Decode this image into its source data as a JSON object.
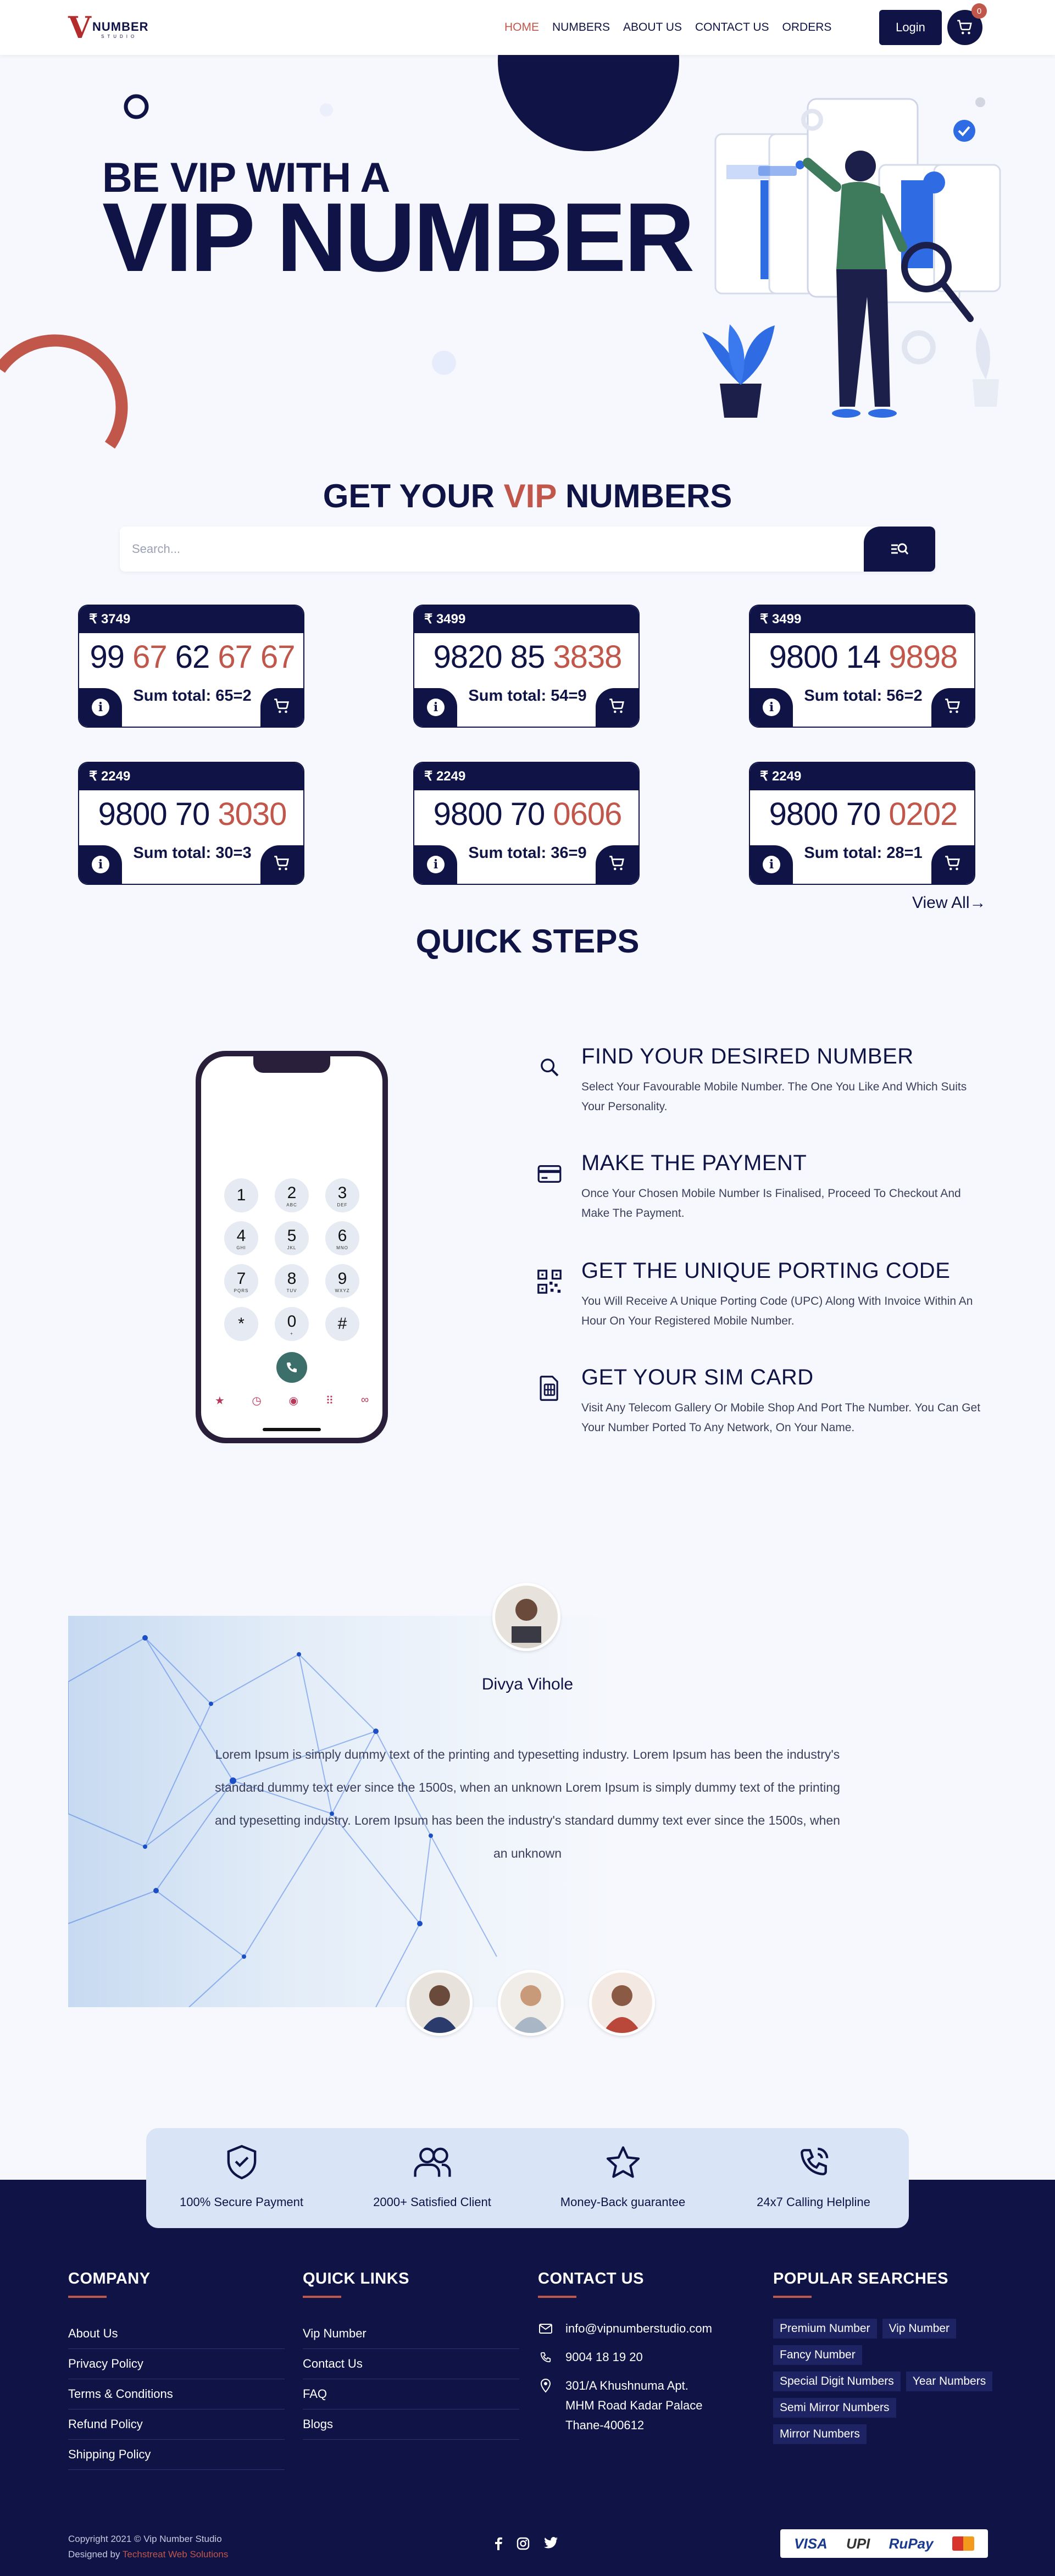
{
  "nav": {
    "logo": {
      "mark": "V",
      "name": "NUMBER",
      "sub": "STUDIO"
    },
    "links": [
      "HOME",
      "NUMBERS",
      "ABOUT US",
      "CONTACT US",
      "ORDERS"
    ],
    "login": "Login",
    "cart_count": "0"
  },
  "hero": {
    "line1": "BE VIP WITH A",
    "line2": "VIP NUMBER"
  },
  "numbers_section": {
    "title_pre": "GET YOUR ",
    "title_accent": "VIP",
    "title_post": " NUMBERS",
    "search_placeholder": "Search...",
    "cards": [
      {
        "price": "₹ 3749",
        "num_plain": "99 ",
        "num_parts": [
          [
            "99 ",
            false
          ],
          [
            "67",
            true
          ],
          [
            " 62 ",
            false
          ],
          [
            "67 67",
            true
          ]
        ],
        "sum": "Sum total: 65=2"
      },
      {
        "price": "₹ 3499",
        "num_parts": [
          [
            "9820 85 ",
            false
          ],
          [
            "3838",
            true
          ]
        ],
        "sum": "Sum total: 54=9"
      },
      {
        "price": "₹ 3499",
        "num_parts": [
          [
            "9800 14 ",
            false
          ],
          [
            "9898",
            true
          ]
        ],
        "sum": "Sum total: 56=2"
      },
      {
        "price": "₹ 2249",
        "num_parts": [
          [
            "9800 70 ",
            false
          ],
          [
            "3030",
            true
          ]
        ],
        "sum": "Sum total: 30=3"
      },
      {
        "price": "₹ 2249",
        "num_parts": [
          [
            "9800 70 ",
            false
          ],
          [
            "0606",
            true
          ]
        ],
        "sum": "Sum total: 36=9"
      },
      {
        "price": "₹ 2249",
        "num_parts": [
          [
            "9800 70 ",
            false
          ],
          [
            "0202",
            true
          ]
        ],
        "sum": "Sum total: 28=1"
      }
    ],
    "view_all": "View All→"
  },
  "steps": {
    "title": "QUICK STEPS",
    "keypad": [
      [
        "1",
        ""
      ],
      [
        "2",
        "ABC"
      ],
      [
        "3",
        "DEF"
      ],
      [
        "4",
        "GHI"
      ],
      [
        "5",
        "JKL"
      ],
      [
        "6",
        "MNO"
      ],
      [
        "7",
        "PQRS"
      ],
      [
        "8",
        "TUV"
      ],
      [
        "9",
        "WXYZ"
      ],
      [
        "*",
        ""
      ],
      [
        "0",
        "+"
      ],
      [
        "#",
        ""
      ]
    ],
    "items": [
      {
        "icon": "search-icon",
        "title": "FIND YOUR DESIRED NUMBER",
        "text": "Select Your Favourable Mobile Number. The One You Like And Which Suits Your Personality."
      },
      {
        "icon": "credit-card-icon",
        "title": "MAKE THE PAYMENT",
        "text": "Once Your Chosen Mobile Number Is Finalised, Proceed To Checkout And Make The Payment."
      },
      {
        "icon": "qr-code-icon",
        "title": "GET THE UNIQUE PORTING CODE",
        "text": "You Will Receive A Unique Porting Code (UPC) Along With Invoice Within An Hour On Your Registered Mobile Number."
      },
      {
        "icon": "sim-card-icon",
        "title": "GET YOUR SIM CARD",
        "text": "Visit Any Telecom Gallery Or Mobile Shop And Port The Number. You Can Get Your Number Ported To Any Network, On Your Name."
      }
    ]
  },
  "testimonial": {
    "name": "Divya Vihole",
    "text": "Lorem Ipsum is simply dummy text of the printing and typesetting industry. Lorem Ipsum has been the industry's standard dummy text ever since the 1500s, when an unknown Lorem Ipsum is simply dummy text of the printing and typesetting industry. Lorem Ipsum has been the industry's standard dummy text ever since the 1500s, when an unknown"
  },
  "features": [
    {
      "icon": "shield-check-icon",
      "label": "100% Secure Payment"
    },
    {
      "icon": "users-icon",
      "label": "2000+ Satisfied Client"
    },
    {
      "icon": "star-icon",
      "label": "Money-Back guarantee"
    },
    {
      "icon": "phone-call-icon",
      "label": "24x7 Calling Helpline"
    }
  ],
  "footer": {
    "company": {
      "title": "COMPANY",
      "links": [
        "About Us",
        "Privacy Policy",
        "Terms & Conditions",
        "Refund Policy",
        "Shipping Policy"
      ]
    },
    "quick_links": {
      "title": "QUICK LINKS",
      "links": [
        "Vip Number",
        "Contact Us",
        "FAQ",
        "Blogs"
      ]
    },
    "contact": {
      "title": "CONTACT US",
      "email": "info@vipnumberstudio.com",
      "phone": "9004 18 19 20",
      "address": [
        "301/A Khushnuma Apt.",
        "MHM Road Kadar Palace",
        "Thane-400612"
      ]
    },
    "popular": {
      "title": "POPULAR SEARCHES",
      "tags": [
        "Premium Number",
        "Vip Number",
        "Fancy Number",
        "Special Digit Numbers",
        "Year Numbers",
        "Semi Mirror Numbers",
        "Mirror Numbers"
      ]
    },
    "copyright": "Copyright 2021 © Vip Number Studio",
    "designed_pre": "Designed by ",
    "designer": "Techstreat Web Solutions",
    "payments": [
      "VISA",
      "UPI",
      "RuPay"
    ]
  },
  "colors": {
    "navy": "#0f1346",
    "accent": "#c0574a",
    "bg": "#f6f8fd",
    "strip": "#d9e5f6"
  }
}
